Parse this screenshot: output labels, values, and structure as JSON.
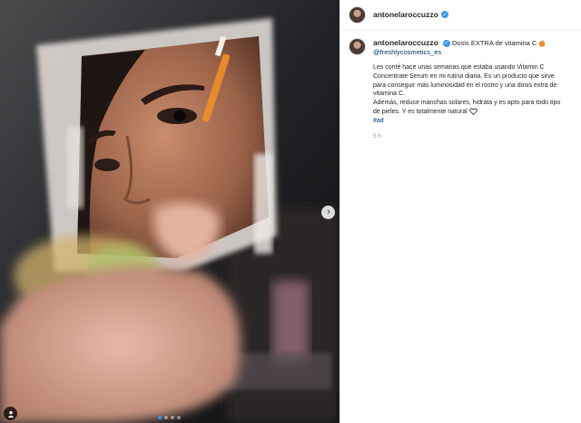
{
  "post": {
    "author": "antonelaroccuzzo",
    "caption_title": "Dosis EXTRA de vitamina C",
    "caption_title_emoji": "orange-emoji-icon",
    "mention": "@freshlycosmetics_es",
    "paragraph_1": "Les conté hace unas semanas que estaba usando Vitamin C Concentrate Serum en mi rutina diaria. Es un producto que sirve para conseguir más luminosidad en el rostro y una dosis extra de vitamina C.",
    "paragraph_2": "Además, reduce manchas solares, hidrata y es apto para todo tipo de pieles. Y es totalmente natural",
    "paragraph_2_emoji": "white-heart-icon",
    "hashtag": "#ad",
    "timestamp": "5 h"
  },
  "carousel": {
    "slides": 4,
    "active_slide": 1
  },
  "colors": {
    "link": "#00376b",
    "verified": "#3897f0",
    "dot_active": "#3a8ef6",
    "muted": "#8e8e8e"
  }
}
